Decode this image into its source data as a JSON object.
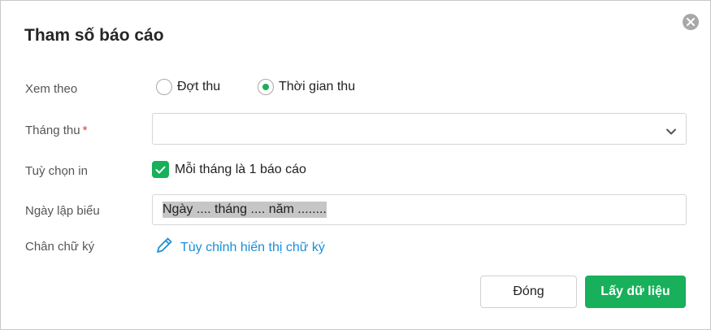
{
  "dialog": {
    "title": "Tham số báo cáo",
    "close_icon": "close-circle-icon"
  },
  "form": {
    "view_by": {
      "label": "Xem theo",
      "options": [
        {
          "label": "Đợt thu",
          "selected": false
        },
        {
          "label": "Thời gian thu",
          "selected": true
        }
      ]
    },
    "month": {
      "label": "Tháng thu",
      "required_mark": "*",
      "value": "",
      "icon": "chevron-down-icon"
    },
    "print_option": {
      "label": "Tuỳ chọn in",
      "checkbox_label": "Mỗi tháng là 1 báo cáo",
      "checked": true
    },
    "report_date": {
      "label": "Ngày lập biểu",
      "value": "Ngày .... tháng .... năm ........"
    },
    "signature": {
      "label": "Chân chữ ký",
      "link_label": "Tùy chỉnh hiển thị chữ ký",
      "icon": "pencil-icon"
    }
  },
  "buttons": {
    "close_label": "Đóng",
    "submit_label": "Lấy dữ liệu"
  },
  "colors": {
    "accent": "#18b05a",
    "link": "#1a8fd8",
    "required": "#e53935"
  }
}
